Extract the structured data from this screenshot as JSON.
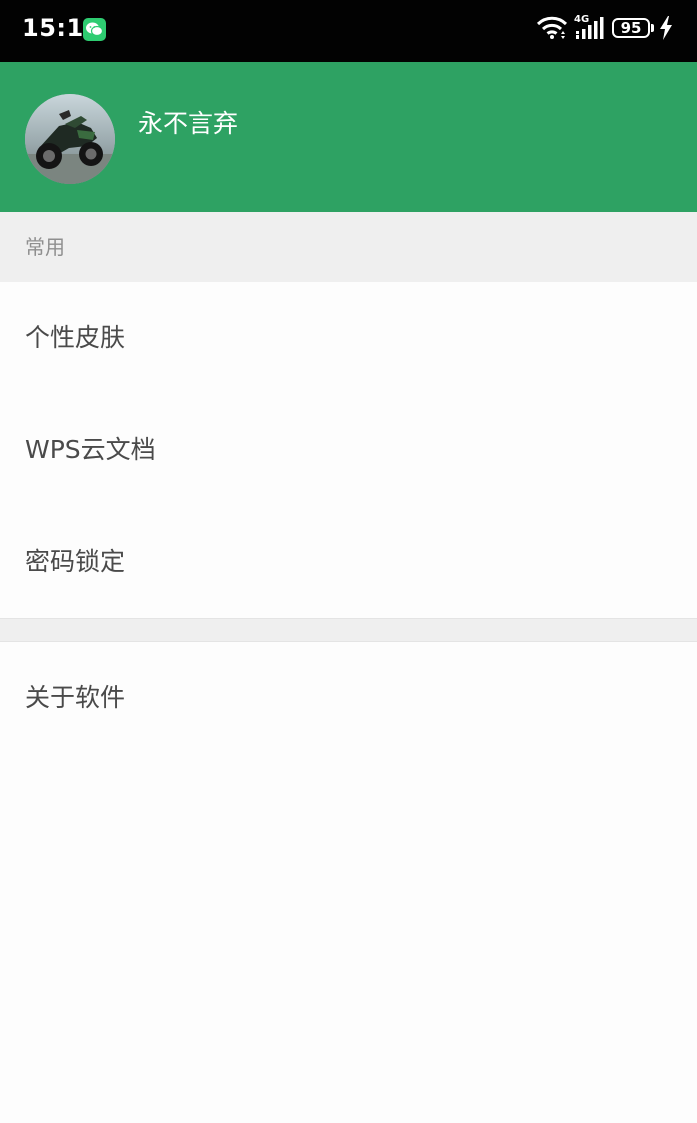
{
  "status_bar": {
    "time": "15:15",
    "network_label": "4G",
    "battery_level": "95",
    "notification_app_icon": "wechat-icon",
    "icons": [
      "wifi-icon",
      "cellular-signal-icon",
      "battery-icon",
      "charging-icon"
    ]
  },
  "profile": {
    "username": "永不言弃",
    "avatar_icon": "motorcycle-avatar",
    "header_color": "#2ea263"
  },
  "section": {
    "title": "常用"
  },
  "menu": {
    "group1": [
      {
        "label": "个性皮肤"
      },
      {
        "label": "WPS云文档"
      },
      {
        "label": "密码锁定"
      }
    ],
    "group2": [
      {
        "label": "关于软件"
      }
    ]
  }
}
